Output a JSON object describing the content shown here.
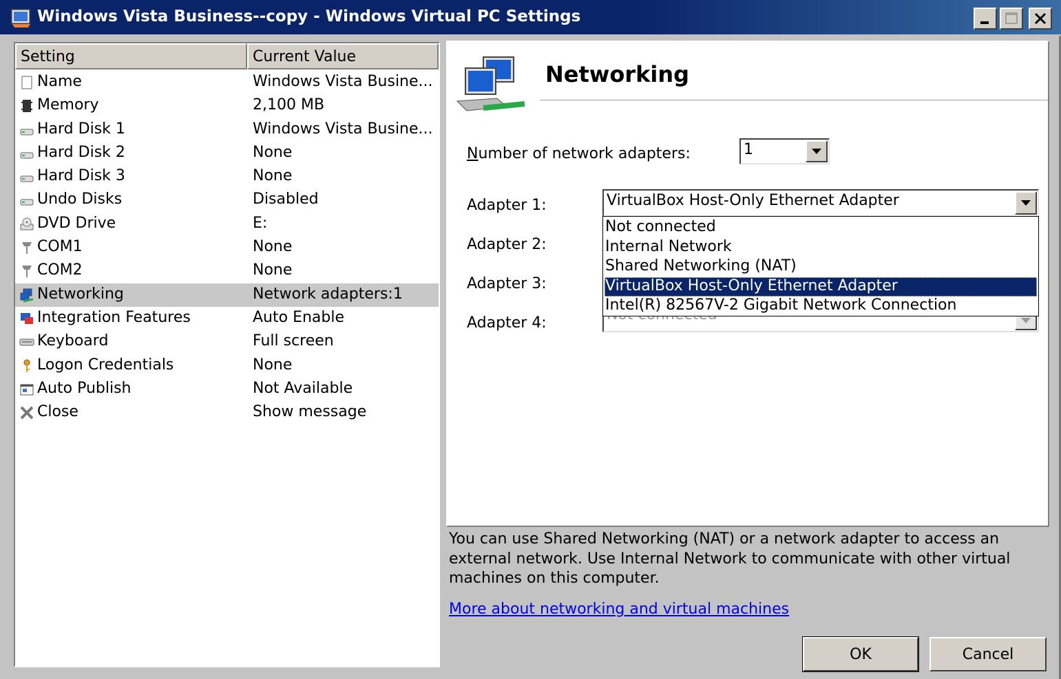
{
  "window": {
    "title": "Windows Vista Business--copy - Windows Virtual PC Settings"
  },
  "list": {
    "headers": {
      "setting": "Setting",
      "value": "Current Value"
    },
    "rows": [
      {
        "name": "Name",
        "value": "Windows Vista Busine...",
        "icon": "document-icon"
      },
      {
        "name": "Memory",
        "value": "2,100 MB",
        "icon": "memory-chip-icon"
      },
      {
        "name": "Hard Disk 1",
        "value": "Windows Vista Busine...",
        "icon": "hard-disk-icon"
      },
      {
        "name": "Hard Disk 2",
        "value": "None",
        "icon": "hard-disk-icon"
      },
      {
        "name": "Hard Disk 3",
        "value": "None",
        "icon": "hard-disk-icon"
      },
      {
        "name": "Undo Disks",
        "value": "Disabled",
        "icon": "hard-disk-icon"
      },
      {
        "name": "DVD Drive",
        "value": "E:",
        "icon": "dvd-drive-icon"
      },
      {
        "name": "COM1",
        "value": "None",
        "icon": "serial-port-icon"
      },
      {
        "name": "COM2",
        "value": "None",
        "icon": "serial-port-icon"
      },
      {
        "name": "Networking",
        "value": "Network adapters:1",
        "icon": "network-icon",
        "selected": true
      },
      {
        "name": "Integration Features",
        "value": "Auto Enable",
        "icon": "integration-icon"
      },
      {
        "name": "Keyboard",
        "value": "Full screen",
        "icon": "keyboard-icon"
      },
      {
        "name": "Logon Credentials",
        "value": "None",
        "icon": "key-icon"
      },
      {
        "name": "Auto Publish",
        "value": "Not Available",
        "icon": "window-icon"
      },
      {
        "name": "Close",
        "value": "Show message",
        "icon": "close-x-icon"
      }
    ]
  },
  "panel": {
    "title": "Networking",
    "num_adapters_label": "Number of network adapters:",
    "num_adapters_value": "1",
    "adapter1_label": "Adapter 1:",
    "adapter1_value": "VirtualBox Host-Only Ethernet Adapter",
    "adapter2_label": "Adapter 2:",
    "adapter3_label": "Adapter 3:",
    "adapter4_label": "Adapter 4:",
    "adapter4_value": "Not connected",
    "dropdown_options": [
      "Not connected",
      "Internal Network",
      "Shared Networking (NAT)",
      "VirtualBox Host-Only Ethernet Adapter",
      "Intel(R) 82567V-2 Gigabit Network Connection"
    ],
    "dropdown_highlighted": "VirtualBox Host-Only Ethernet Adapter"
  },
  "description": "You can use Shared Networking (NAT) or a network adapter to access an external network. Use Internal Network to communicate with other virtual machines on this computer.",
  "link_text": "More about networking and virtual machines",
  "buttons": {
    "ok": "OK",
    "cancel": "Cancel"
  },
  "colors": {
    "titlebar": "#0a246a",
    "selection": "#0a246a",
    "link": "#0000ee"
  }
}
